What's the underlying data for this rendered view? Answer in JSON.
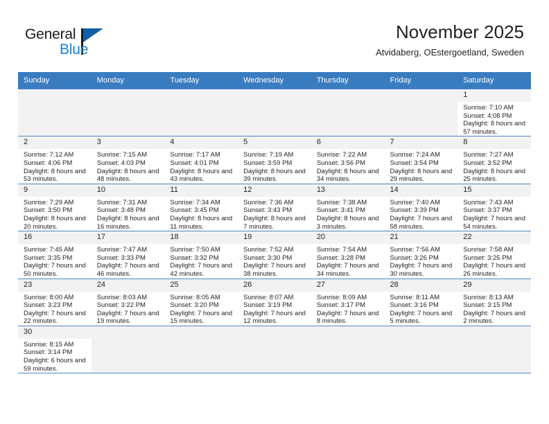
{
  "brand": {
    "name_part1": "General",
    "name_part2": "Blue",
    "accent_color": "#1b7fd4",
    "flag_color": "#1060a8"
  },
  "header": {
    "title": "November 2025",
    "subtitle": "Atvidaberg, OEstergoetland, Sweden"
  },
  "calendar": {
    "header_color": "#3a7cc0",
    "weekdays": [
      "Sunday",
      "Monday",
      "Tuesday",
      "Wednesday",
      "Thursday",
      "Friday",
      "Saturday"
    ],
    "labels": {
      "sunrise": "Sunrise:",
      "sunset": "Sunset:",
      "daylight": "Daylight:"
    },
    "weeks": [
      [
        {
          "day": "",
          "empty": true
        },
        {
          "day": "",
          "empty": true
        },
        {
          "day": "",
          "empty": true
        },
        {
          "day": "",
          "empty": true
        },
        {
          "day": "",
          "empty": true
        },
        {
          "day": "",
          "empty": true
        },
        {
          "day": "1",
          "sunrise": "Sunrise: 7:10 AM",
          "sunset": "Sunset: 4:08 PM",
          "daylight": "Daylight: 8 hours and 57 minutes."
        }
      ],
      [
        {
          "day": "2",
          "sunrise": "Sunrise: 7:12 AM",
          "sunset": "Sunset: 4:06 PM",
          "daylight": "Daylight: 8 hours and 53 minutes."
        },
        {
          "day": "3",
          "sunrise": "Sunrise: 7:15 AM",
          "sunset": "Sunset: 4:03 PM",
          "daylight": "Daylight: 8 hours and 48 minutes."
        },
        {
          "day": "4",
          "sunrise": "Sunrise: 7:17 AM",
          "sunset": "Sunset: 4:01 PM",
          "daylight": "Daylight: 8 hours and 43 minutes."
        },
        {
          "day": "5",
          "sunrise": "Sunrise: 7:19 AM",
          "sunset": "Sunset: 3:59 PM",
          "daylight": "Daylight: 8 hours and 39 minutes."
        },
        {
          "day": "6",
          "sunrise": "Sunrise: 7:22 AM",
          "sunset": "Sunset: 3:56 PM",
          "daylight": "Daylight: 8 hours and 34 minutes."
        },
        {
          "day": "7",
          "sunrise": "Sunrise: 7:24 AM",
          "sunset": "Sunset: 3:54 PM",
          "daylight": "Daylight: 8 hours and 29 minutes."
        },
        {
          "day": "8",
          "sunrise": "Sunrise: 7:27 AM",
          "sunset": "Sunset: 3:52 PM",
          "daylight": "Daylight: 8 hours and 25 minutes."
        }
      ],
      [
        {
          "day": "9",
          "sunrise": "Sunrise: 7:29 AM",
          "sunset": "Sunset: 3:50 PM",
          "daylight": "Daylight: 8 hours and 20 minutes."
        },
        {
          "day": "10",
          "sunrise": "Sunrise: 7:31 AM",
          "sunset": "Sunset: 3:48 PM",
          "daylight": "Daylight: 8 hours and 16 minutes."
        },
        {
          "day": "11",
          "sunrise": "Sunrise: 7:34 AM",
          "sunset": "Sunset: 3:45 PM",
          "daylight": "Daylight: 8 hours and 11 minutes."
        },
        {
          "day": "12",
          "sunrise": "Sunrise: 7:36 AM",
          "sunset": "Sunset: 3:43 PM",
          "daylight": "Daylight: 8 hours and 7 minutes."
        },
        {
          "day": "13",
          "sunrise": "Sunrise: 7:38 AM",
          "sunset": "Sunset: 3:41 PM",
          "daylight": "Daylight: 8 hours and 3 minutes."
        },
        {
          "day": "14",
          "sunrise": "Sunrise: 7:40 AM",
          "sunset": "Sunset: 3:39 PM",
          "daylight": "Daylight: 7 hours and 58 minutes."
        },
        {
          "day": "15",
          "sunrise": "Sunrise: 7:43 AM",
          "sunset": "Sunset: 3:37 PM",
          "daylight": "Daylight: 7 hours and 54 minutes."
        }
      ],
      [
        {
          "day": "16",
          "sunrise": "Sunrise: 7:45 AM",
          "sunset": "Sunset: 3:35 PM",
          "daylight": "Daylight: 7 hours and 50 minutes."
        },
        {
          "day": "17",
          "sunrise": "Sunrise: 7:47 AM",
          "sunset": "Sunset: 3:33 PM",
          "daylight": "Daylight: 7 hours and 46 minutes."
        },
        {
          "day": "18",
          "sunrise": "Sunrise: 7:50 AM",
          "sunset": "Sunset: 3:32 PM",
          "daylight": "Daylight: 7 hours and 42 minutes."
        },
        {
          "day": "19",
          "sunrise": "Sunrise: 7:52 AM",
          "sunset": "Sunset: 3:30 PM",
          "daylight": "Daylight: 7 hours and 38 minutes."
        },
        {
          "day": "20",
          "sunrise": "Sunrise: 7:54 AM",
          "sunset": "Sunset: 3:28 PM",
          "daylight": "Daylight: 7 hours and 34 minutes."
        },
        {
          "day": "21",
          "sunrise": "Sunrise: 7:56 AM",
          "sunset": "Sunset: 3:26 PM",
          "daylight": "Daylight: 7 hours and 30 minutes."
        },
        {
          "day": "22",
          "sunrise": "Sunrise: 7:58 AM",
          "sunset": "Sunset: 3:25 PM",
          "daylight": "Daylight: 7 hours and 26 minutes."
        }
      ],
      [
        {
          "day": "23",
          "sunrise": "Sunrise: 8:00 AM",
          "sunset": "Sunset: 3:23 PM",
          "daylight": "Daylight: 7 hours and 22 minutes."
        },
        {
          "day": "24",
          "sunrise": "Sunrise: 8:03 AM",
          "sunset": "Sunset: 3:22 PM",
          "daylight": "Daylight: 7 hours and 19 minutes."
        },
        {
          "day": "25",
          "sunrise": "Sunrise: 8:05 AM",
          "sunset": "Sunset: 3:20 PM",
          "daylight": "Daylight: 7 hours and 15 minutes."
        },
        {
          "day": "26",
          "sunrise": "Sunrise: 8:07 AM",
          "sunset": "Sunset: 3:19 PM",
          "daylight": "Daylight: 7 hours and 12 minutes."
        },
        {
          "day": "27",
          "sunrise": "Sunrise: 8:09 AM",
          "sunset": "Sunset: 3:17 PM",
          "daylight": "Daylight: 7 hours and 8 minutes."
        },
        {
          "day": "28",
          "sunrise": "Sunrise: 8:11 AM",
          "sunset": "Sunset: 3:16 PM",
          "daylight": "Daylight: 7 hours and 5 minutes."
        },
        {
          "day": "29",
          "sunrise": "Sunrise: 8:13 AM",
          "sunset": "Sunset: 3:15 PM",
          "daylight": "Daylight: 7 hours and 2 minutes."
        }
      ],
      [
        {
          "day": "30",
          "sunrise": "Sunrise: 8:15 AM",
          "sunset": "Sunset: 3:14 PM",
          "daylight": "Daylight: 6 hours and 59 minutes."
        },
        {
          "day": "",
          "empty": true
        },
        {
          "day": "",
          "empty": true
        },
        {
          "day": "",
          "empty": true
        },
        {
          "day": "",
          "empty": true
        },
        {
          "day": "",
          "empty": true
        },
        {
          "day": "",
          "empty": true
        }
      ]
    ]
  }
}
